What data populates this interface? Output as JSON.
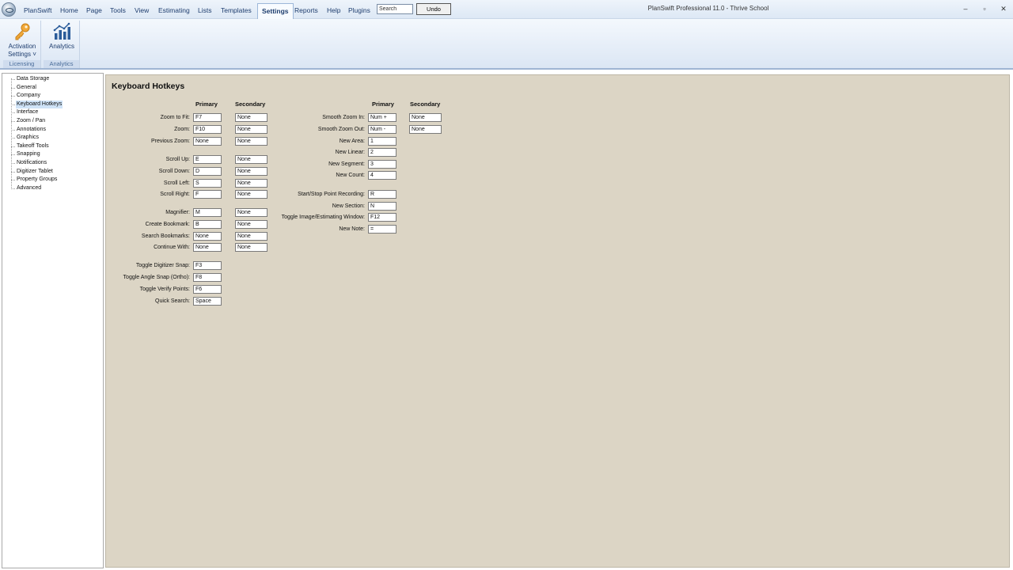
{
  "menu": [
    "PlanSwift",
    "Home",
    "Page",
    "Tools",
    "View",
    "Estimating",
    "Lists",
    "Templates",
    "Settings",
    "Reports",
    "Help",
    "Plugins"
  ],
  "active_menu": "Settings",
  "search": {
    "value": "Search"
  },
  "undo_label": "Undo",
  "window_title": "PlanSwift Professional 11.0 - Thrive School",
  "window_controls": {
    "minimize": "–",
    "restore": "▫",
    "close": "✕"
  },
  "ribbon": {
    "groups": [
      {
        "label": "Licensing",
        "buttons": [
          {
            "label_line1": "Activation",
            "label_line2": "Settings ˅",
            "icon": "key-icon"
          }
        ]
      },
      {
        "label": "Analytics",
        "buttons": [
          {
            "label_line1": "Analytics",
            "icon": "analytics-chart-icon"
          }
        ]
      }
    ]
  },
  "tree": {
    "items": [
      "Data Storage",
      "General",
      "Company",
      "Keyboard Hotkeys",
      "Interface",
      "Zoom / Pan",
      "Annotations",
      "Graphics",
      "Takeoff Tools",
      "Snapping",
      "Notifications",
      "Digitizer Tablet",
      "Property Groups",
      "Advanced"
    ],
    "selected": "Keyboard Hotkeys"
  },
  "panel": {
    "title": "Keyboard Hotkeys",
    "col_primary": "Primary",
    "col_secondary": "Secondary",
    "left": [
      {
        "label": "Zoom to Fit:",
        "primary": "F7",
        "secondary": "None"
      },
      {
        "label": "Zoom:",
        "primary": "F10",
        "secondary": "None"
      },
      {
        "label": "Previous Zoom:",
        "primary": "None",
        "secondary": "None"
      },
      {
        "label": "Scroll Up:",
        "primary": "E",
        "secondary": "None"
      },
      {
        "label": "Scroll Down:",
        "primary": "D",
        "secondary": "None"
      },
      {
        "label": "Scroll Left:",
        "primary": "S",
        "secondary": "None"
      },
      {
        "label": "Scroll Right:",
        "primary": "F",
        "secondary": "None"
      },
      {
        "label": "Magnifier:",
        "primary": "M",
        "secondary": "None"
      },
      {
        "label": "Create Bookmark:",
        "primary": "B",
        "secondary": "None"
      },
      {
        "label": "Search Bookmarks:",
        "primary": "None",
        "secondary": "None"
      },
      {
        "label": "Continue With:",
        "primary": "None",
        "secondary": "None"
      },
      {
        "label": "Toggle Digitizer Snap:",
        "primary": "F3"
      },
      {
        "label": "Toggle Angle Snap (Ortho):",
        "primary": "F8"
      },
      {
        "label": "Toggle Verify Points:",
        "primary": "F6"
      },
      {
        "label": "Quick Search:",
        "primary": "Space"
      }
    ],
    "right": [
      {
        "label": "Smooth Zoom In:",
        "primary": "Num +",
        "secondary": "None"
      },
      {
        "label": "Smooth Zoom Out:",
        "primary": "Num -",
        "secondary": "None"
      },
      {
        "label": "New Area:",
        "primary": "1"
      },
      {
        "label": "New Linear:",
        "primary": "2"
      },
      {
        "label": "New Segment:",
        "primary": "3"
      },
      {
        "label": "New Count:",
        "primary": "4"
      },
      {
        "label": "Start/Stop Point Recording:",
        "primary": "R"
      },
      {
        "label": "New Section:",
        "primary": "N"
      },
      {
        "label": "Toggle Image/Estimating Window:",
        "primary": "F12"
      },
      {
        "label": "New Note:",
        "primary": "="
      }
    ]
  },
  "colors": {
    "content_bg": "#dcd5c5",
    "ribbon_label": "#4a6d9a",
    "selected_tree": "#cfe3f7"
  }
}
